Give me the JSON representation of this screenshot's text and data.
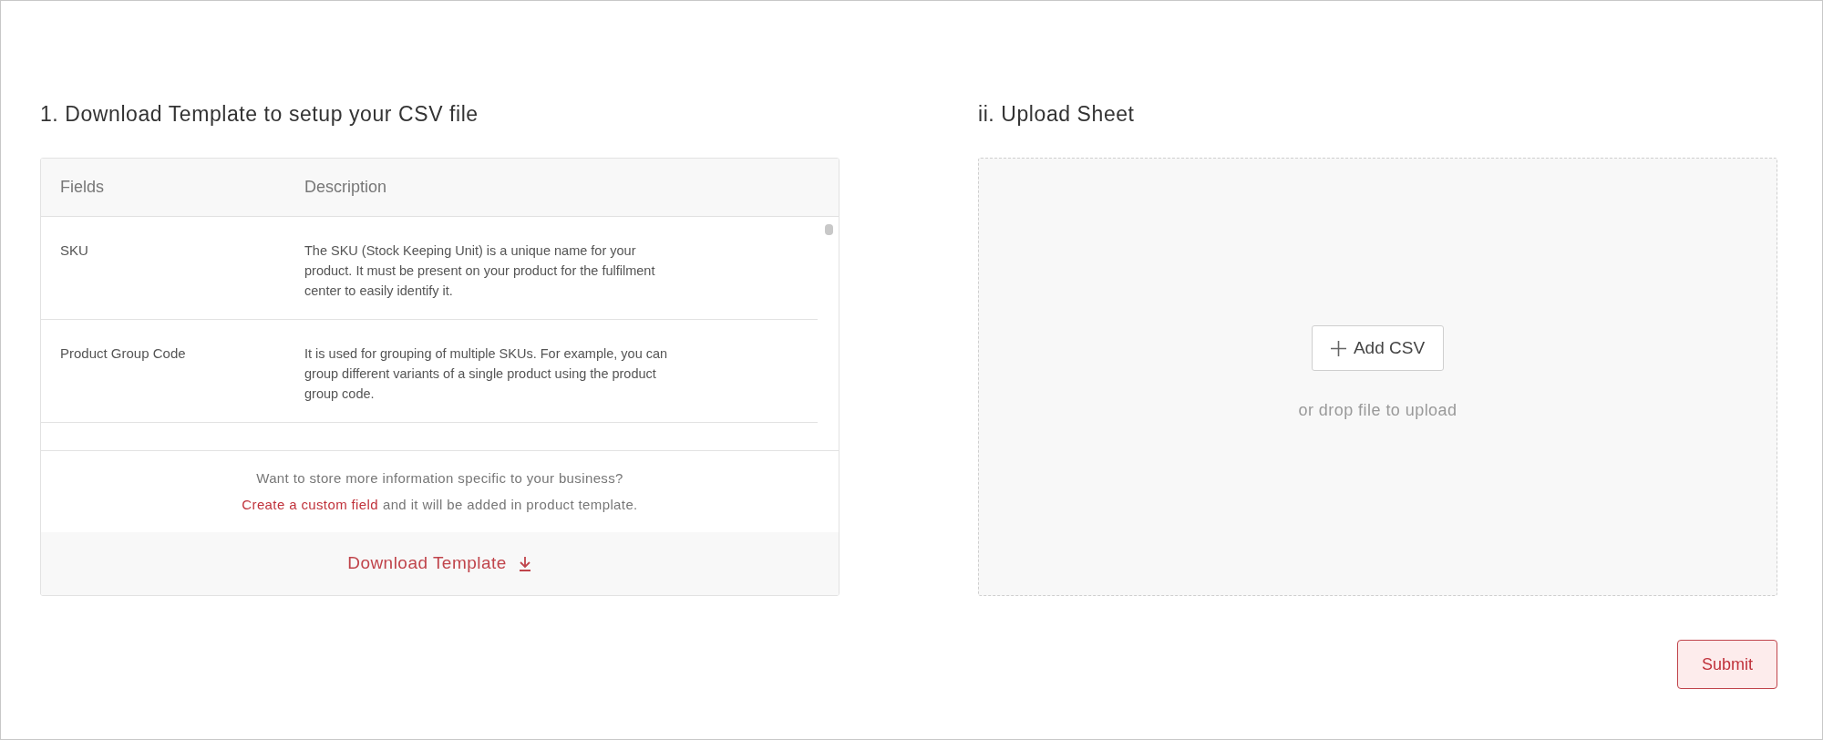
{
  "template_section": {
    "title": "1. Download Template to setup your CSV file",
    "table": {
      "columns": [
        "Fields",
        "Description"
      ],
      "rows": [
        {
          "field": "SKU",
          "description": "The SKU (Stock Keeping Unit) is a unique name for your product. It must be present on your product for the fulfilment center to easily identify it."
        },
        {
          "field": "Product Group Code",
          "description": "It is used for grouping of multiple SKUs. For example, you can group different variants of a single product using the product group code."
        }
      ]
    },
    "custom_prompt": "Want to store more information specific to your business?",
    "custom_link": "Create a custom field",
    "custom_suffix": "and it will be added in product template.",
    "download_button": "Download Template"
  },
  "upload_section": {
    "title": "ii. Upload Sheet",
    "add_button": "Add CSV",
    "drop_hint": "or drop file to upload"
  },
  "submit_button": "Submit"
}
